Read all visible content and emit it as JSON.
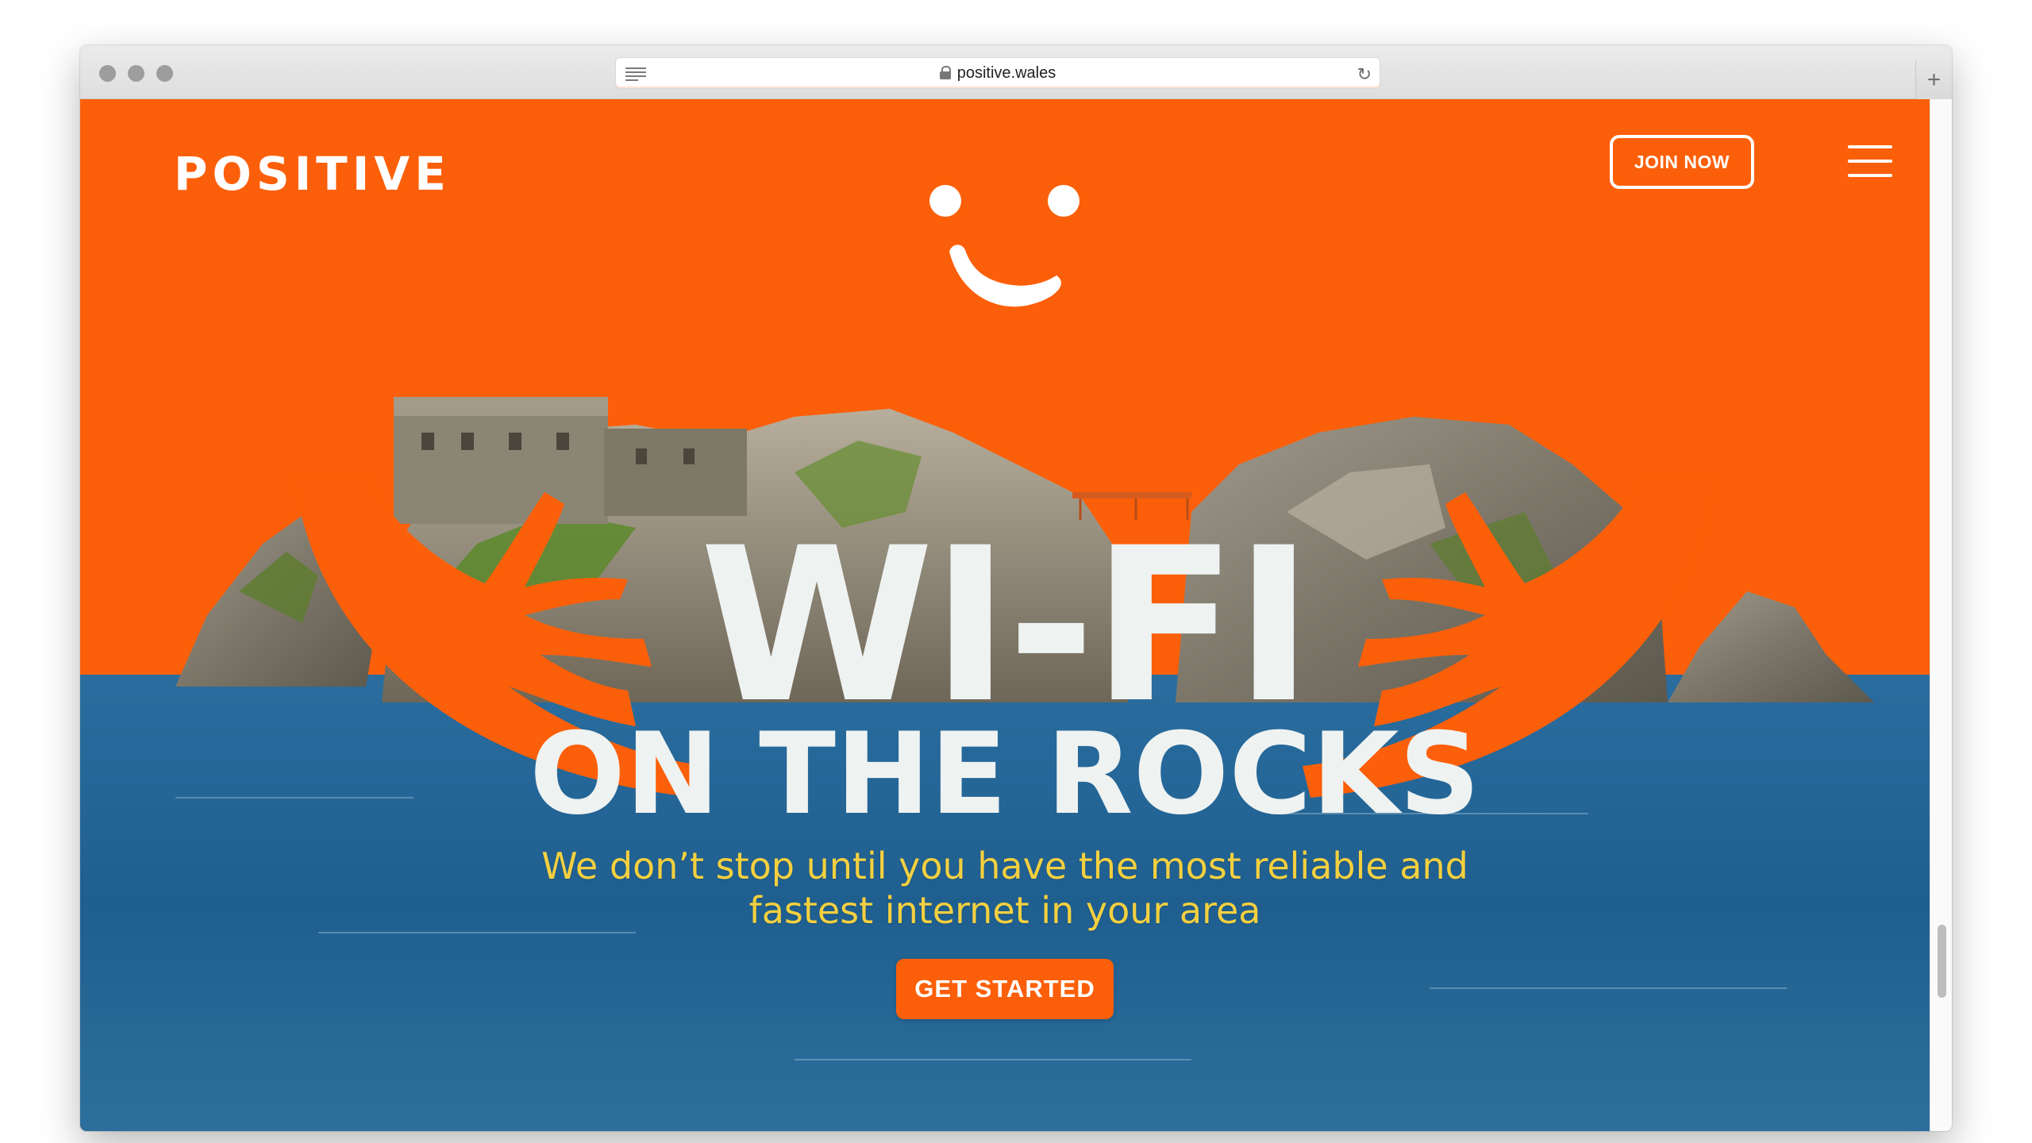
{
  "browser": {
    "url": "positive.wales"
  },
  "header": {
    "logo": "POSITIVE",
    "join_label": "JOIN NOW"
  },
  "hero": {
    "title_line1": "WI-FI",
    "title_line2": "ON THE ROCKS",
    "subtitle": "We don’t stop until you have the most reliable and fastest internet in your area",
    "cta_label": "GET STARTED"
  },
  "colors": {
    "brand_orange": "#fc5f09",
    "headline": "#eef2f1",
    "subtitle": "#f4d03f",
    "sea": "#2a6d9e"
  },
  "icons": [
    "reader-icon",
    "lock-icon",
    "reload-icon",
    "new-tab-icon",
    "menu-icon",
    "smiley-face-icon"
  ]
}
